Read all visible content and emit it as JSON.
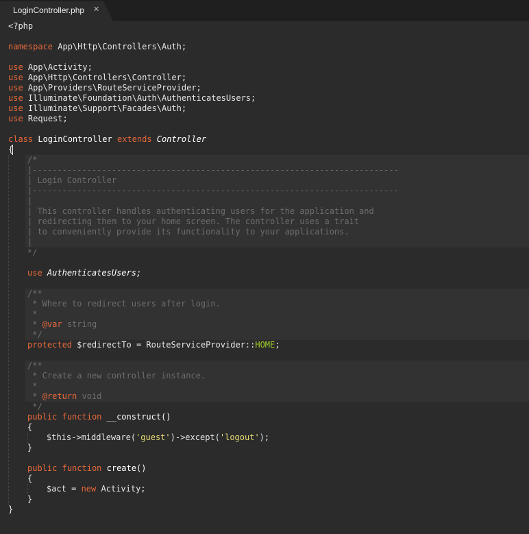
{
  "tab": {
    "title": "LoginController.php",
    "close_glyph": "✕"
  },
  "code": {
    "php_open": "<?php",
    "namespace_kw": "namespace",
    "namespace_name": "App\\Http\\Controllers\\Auth;",
    "use_kw": "use",
    "imports": [
      "App\\Activity;",
      "App\\Http\\Controllers\\Controller;",
      "App\\Providers\\RouteServiceProvider;",
      "Illuminate\\Foundation\\Auth\\AuthenticatesUsers;",
      "Illuminate\\Support\\Facades\\Auth;",
      "Request;"
    ],
    "class_kw": "class",
    "class_name": "LoginController",
    "extends_kw": "extends",
    "parent_class": "Controller",
    "open_brace": "{",
    "close_brace": "}",
    "docblock_main": [
      "/*",
      "|--------------------------------------------------------------------------",
      "| Login Controller",
      "|--------------------------------------------------------------------------",
      "|",
      "| This controller handles authenticating users for the application and",
      "| redirecting them to your home screen. The controller uses a trait",
      "| to conveniently provide its functionality to your applications.",
      "|",
      "*/"
    ],
    "trait_name": "AuthenticatesUsers;",
    "doc_redirect": {
      "open": "/**",
      "desc": " * Where to redirect users after login.",
      "star": " *",
      "tag_prefix": " * ",
      "tag": "@var",
      "tag_type": " string",
      "close": " */"
    },
    "protected_kw": "protected",
    "redirect_prop": " $redirectTo = RouteServiceProvider::",
    "redirect_const": "HOME",
    "redirect_end": ";",
    "doc_construct": {
      "open": "/**",
      "desc": " * Create a new controller instance.",
      "star": " *",
      "tag_prefix": " * ",
      "tag": "@return",
      "tag_type": " void",
      "close": " */"
    },
    "public_kw": "public",
    "function_kw": "function",
    "construct_name": " __construct()",
    "middleware_pre": "$this->middleware(",
    "middleware_arg": "'guest'",
    "middleware_mid": ")->except(",
    "except_arg": "'logout'",
    "middleware_end": ");",
    "create_name": " create()",
    "act_var": "$act = ",
    "new_kw": "new",
    "act_class": " Activity;"
  }
}
